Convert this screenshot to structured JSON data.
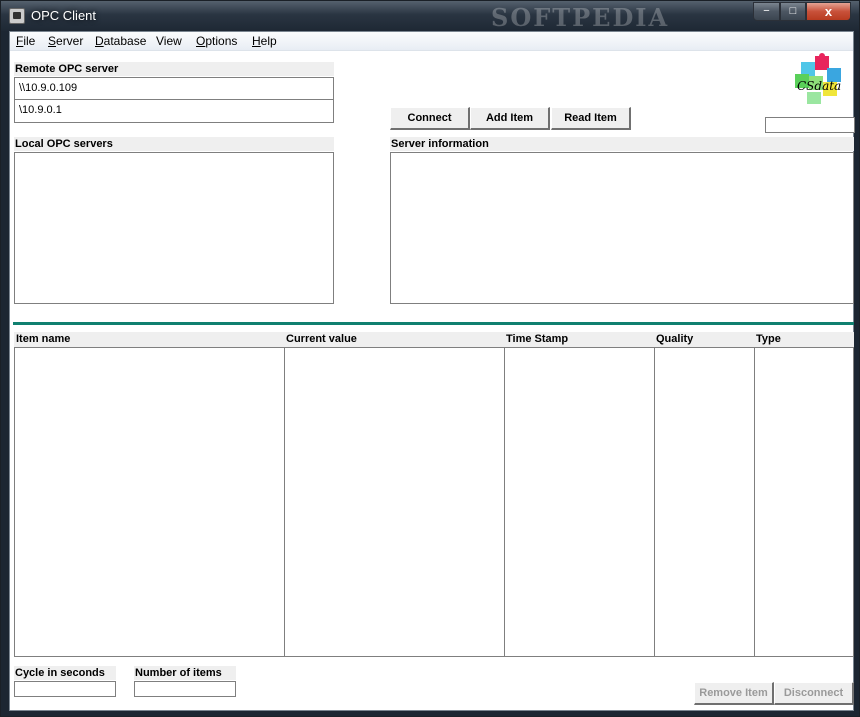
{
  "window": {
    "title": "OPC Client",
    "watermark": "SOFTPEDIA",
    "controls": {
      "minimize": "−",
      "maximize": "□",
      "close": "x"
    }
  },
  "menu": {
    "items": [
      {
        "label": "File",
        "accel": "F",
        "rest": "ile"
      },
      {
        "label": "Server",
        "accel": "S",
        "rest": "erver"
      },
      {
        "label": "Database",
        "accel": "D",
        "rest": "atabase"
      },
      {
        "label": "View",
        "accel": "",
        "rest": "View"
      },
      {
        "label": "Options",
        "accel": "O",
        "rest": "ptions"
      },
      {
        "label": "Help",
        "accel": "H",
        "rest": "elp"
      }
    ]
  },
  "remote": {
    "label": "Remote OPC server",
    "values": [
      "\\\\10.9.0.109",
      "\\10.9.0.1"
    ]
  },
  "local": {
    "label": "Local OPC servers"
  },
  "server_info": {
    "label": "Server information"
  },
  "buttons": {
    "connect": "Connect",
    "add_item": "Add Item",
    "read_item": "Read Item",
    "remove_item": "Remove Item",
    "disconnect": "Disconnect"
  },
  "logo": {
    "text": "CSdata",
    "icon": "puzzle-logo-icon"
  },
  "table": {
    "columns": [
      "Item name",
      "Current value",
      "Time Stamp",
      "Quality",
      "Type"
    ]
  },
  "footer": {
    "cycle_label": "Cycle in seconds",
    "count_label": "Number of items"
  },
  "colors": {
    "accent_line": "#108070",
    "close_button": "#c8513a"
  }
}
